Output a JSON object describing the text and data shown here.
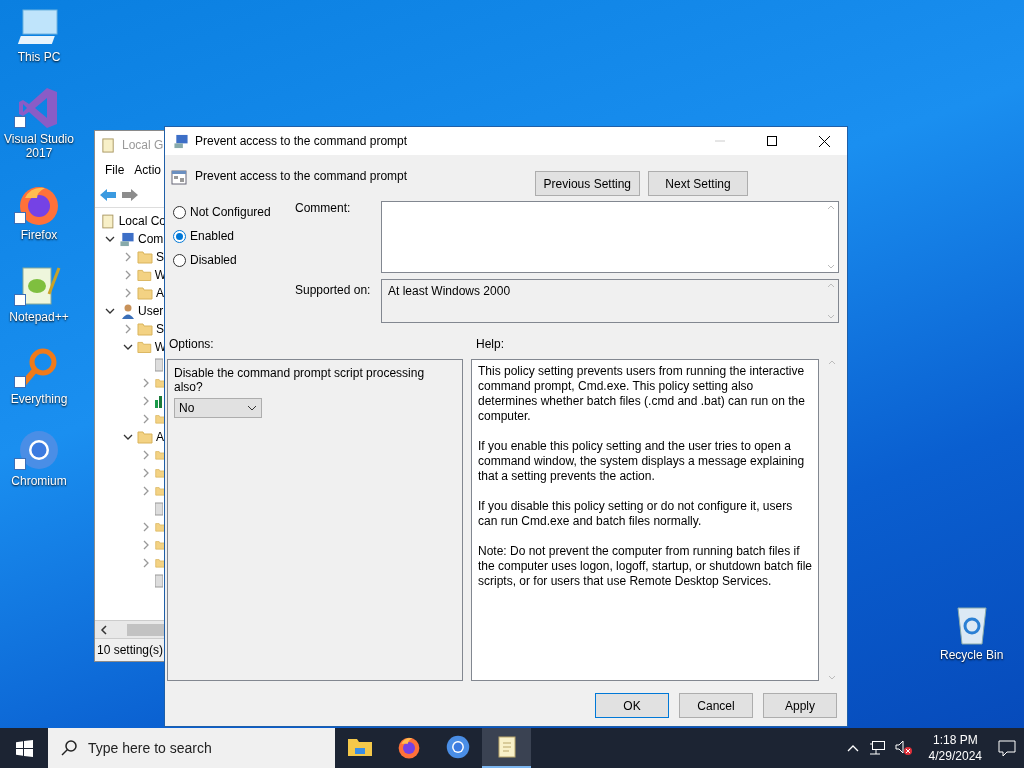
{
  "desktop_icons": [
    {
      "label": "This PC",
      "kind": "pc"
    },
    {
      "label": "Visual Studio 2017",
      "kind": "vs"
    },
    {
      "label": "Firefox",
      "kind": "firefox"
    },
    {
      "label": "Notepad++",
      "kind": "notepad"
    },
    {
      "label": "Everything",
      "kind": "everything"
    },
    {
      "label": "Chromium",
      "kind": "chromium"
    }
  ],
  "recycle_bin": {
    "label": "Recycle Bin"
  },
  "background_window": {
    "title": "Local G",
    "menu": [
      "File",
      "Actio"
    ],
    "tree": [
      {
        "label": "Local Co",
        "kind": "root",
        "children": [
          {
            "label": "Com",
            "kind": "computer",
            "expanded": true,
            "children": [
              {
                "label": "S",
                "kind": "folder",
                "expanded": false
              },
              {
                "label": "W",
                "kind": "folder",
                "expanded": false
              },
              {
                "label": "A",
                "kind": "folder",
                "expanded": false
              }
            ]
          },
          {
            "label": "User",
            "kind": "user",
            "expanded": true,
            "children": [
              {
                "label": "S",
                "kind": "folder",
                "expanded": false
              },
              {
                "label": "W",
                "kind": "folder",
                "expanded": true,
                "children": [
                  {
                    "kind": "leaf"
                  },
                  {
                    "kind": "folder",
                    "expanded": false
                  },
                  {
                    "kind": "chart",
                    "expanded": false
                  },
                  {
                    "kind": "folder",
                    "expanded": false
                  }
                ]
              },
              {
                "label": "A",
                "kind": "folder",
                "expanded": true,
                "children": [
                  {
                    "kind": "folder",
                    "expanded": false
                  },
                  {
                    "kind": "folder",
                    "expanded": false
                  },
                  {
                    "kind": "folder",
                    "expanded": false
                  },
                  {
                    "kind": "leaf"
                  },
                  {
                    "kind": "folder",
                    "expanded": false
                  },
                  {
                    "kind": "folder",
                    "expanded": false
                  },
                  {
                    "kind": "folder",
                    "expanded": false
                  },
                  {
                    "kind": "leaf"
                  }
                ]
              }
            ]
          }
        ]
      }
    ],
    "status": "10 setting(s)"
  },
  "dialog": {
    "title": "Prevent access to the command prompt",
    "heading": "Prevent access to the command prompt",
    "nav_buttons": [
      "Previous Setting",
      "Next Setting"
    ],
    "states": [
      {
        "label": "Not Configured",
        "selected": false
      },
      {
        "label": "Enabled",
        "selected": true
      },
      {
        "label": "Disabled",
        "selected": false
      }
    ],
    "comment": {
      "label": "Comment:"
    },
    "supported_on": {
      "label": "Supported on:",
      "value": "At least Windows 2000"
    },
    "options": {
      "label": "Options:",
      "prompt": "Disable the command prompt script processing also?",
      "dropdown": {
        "value": "No"
      }
    },
    "help": {
      "label": "Help:",
      "paragraphs": [
        "This policy setting prevents users from running the interactive command prompt, Cmd.exe.  This policy setting also determines whether batch files (.cmd and .bat) can run on the computer.",
        "If you enable this policy setting and the user tries to open a command window, the system displays a message explaining that a setting prevents the action.",
        "If you disable this policy setting or do not configure it, users can run Cmd.exe and batch files normally.",
        "Note: Do not prevent the computer from running batch files if the computer uses logon, logoff, startup, or shutdown batch file scripts, or for users that use Remote Desktop Services."
      ]
    },
    "buttons": [
      "OK",
      "Cancel",
      "Apply"
    ]
  },
  "taskbar": {
    "search": {
      "placeholder": "Type here to search"
    },
    "apps": [
      {
        "kind": "explorer",
        "selected": false
      },
      {
        "kind": "firefox",
        "selected": false
      },
      {
        "kind": "chromium",
        "selected": false
      },
      {
        "kind": "notepad",
        "selected": true
      }
    ],
    "time": "1:18 PM",
    "date": "4/29/2024"
  }
}
